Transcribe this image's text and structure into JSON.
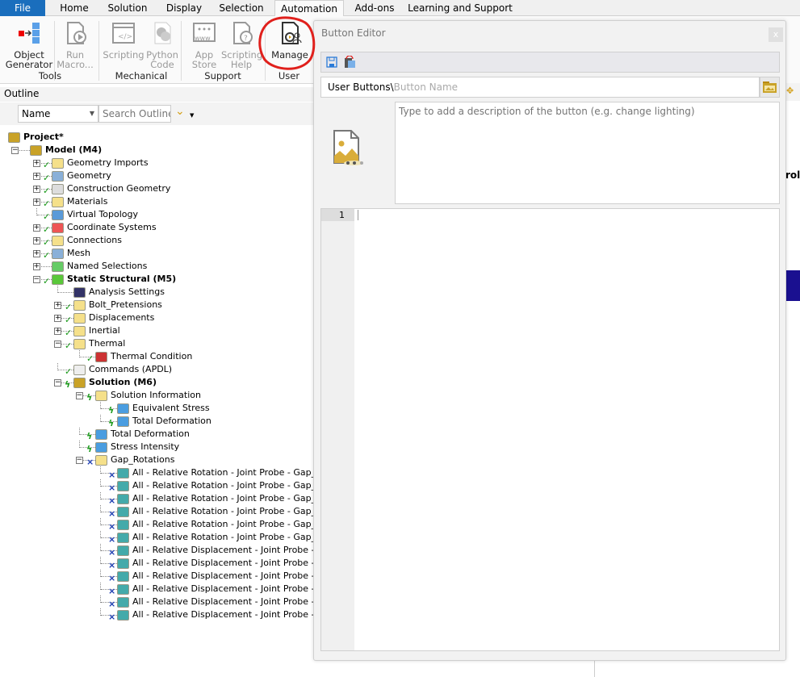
{
  "tabs": [
    "File",
    "Home",
    "Solution",
    "Display",
    "Selection",
    "Automation",
    "Add-ons",
    "Learning and Support"
  ],
  "ribbon": {
    "buttons": [
      {
        "label1": "Object",
        "label2": "Generator",
        "disabled": false,
        "icon": "object-generator-icon"
      },
      {
        "label1": "Run",
        "label2": "Macro...",
        "disabled": true,
        "icon": "run-macro-icon"
      },
      {
        "label1": "Scripting",
        "label2": "",
        "disabled": true,
        "icon": "scripting-icon"
      },
      {
        "label1": "Python",
        "label2": "Code",
        "disabled": true,
        "icon": "python-code-icon"
      },
      {
        "label1": "App",
        "label2": "Store",
        "disabled": true,
        "icon": "app-store-icon"
      },
      {
        "label1": "Scripting",
        "label2": "Help",
        "disabled": true,
        "icon": "scripting-help-icon"
      },
      {
        "label1": "Manage",
        "label2": "",
        "disabled": false,
        "icon": "manage-icon"
      }
    ],
    "groups": [
      "Tools",
      "Mechanical",
      "Support",
      "User"
    ],
    "annotation_color": "#e0201c"
  },
  "outline": {
    "title": "Outline",
    "filter_value": "Name",
    "search_placeholder": "Search Outline"
  },
  "tree": [
    {
      "t": "Project*",
      "l": 0,
      "b": true,
      "e": "",
      "s": "",
      "i": "project"
    },
    {
      "t": "Model (M4)",
      "l": 1,
      "b": true,
      "e": "-",
      "s": "",
      "i": "model"
    },
    {
      "t": "Geometry Imports",
      "l": 2,
      "e": "+",
      "s": "ok",
      "i": "folder"
    },
    {
      "t": "Geometry",
      "l": 2,
      "e": "+",
      "s": "ok",
      "i": "geometry"
    },
    {
      "t": "Construction Geometry",
      "l": 2,
      "e": "+",
      "s": "ok",
      "i": "construction"
    },
    {
      "t": "Materials",
      "l": 2,
      "e": "+",
      "s": "ok",
      "i": "folder"
    },
    {
      "t": "Virtual Topology",
      "l": 2,
      "e": "",
      "s": "ok",
      "i": "topology"
    },
    {
      "t": "Coordinate Systems",
      "l": 2,
      "e": "+",
      "s": "ok",
      "i": "coords"
    },
    {
      "t": "Connections",
      "l": 2,
      "e": "+",
      "s": "ok",
      "i": "folder"
    },
    {
      "t": "Mesh",
      "l": 2,
      "e": "+",
      "s": "ok",
      "i": "geometry"
    },
    {
      "t": "Named Selections",
      "l": 2,
      "e": "+",
      "s": "",
      "i": "named"
    },
    {
      "t": "Static Structural (M5)",
      "l": 2,
      "b": true,
      "e": "-",
      "s": "ok",
      "i": "analysis"
    },
    {
      "t": "Analysis Settings",
      "l": 3,
      "e": "",
      "s": "",
      "i": "settings"
    },
    {
      "t": "Bolt_Pretensions",
      "l": 3,
      "e": "+",
      "s": "ok",
      "i": "folder"
    },
    {
      "t": "Displacements",
      "l": 3,
      "e": "+",
      "s": "ok",
      "i": "folder"
    },
    {
      "t": "Inertial",
      "l": 3,
      "e": "+",
      "s": "ok",
      "i": "folder"
    },
    {
      "t": "Thermal",
      "l": 3,
      "e": "-",
      "s": "ok",
      "i": "folder"
    },
    {
      "t": "Thermal Condition",
      "l": 4,
      "e": "",
      "s": "ok",
      "i": "thermal"
    },
    {
      "t": "Commands (APDL)",
      "l": 3,
      "e": "",
      "s": "ok",
      "i": "commands"
    },
    {
      "t": "Solution (M6)",
      "l": 3,
      "b": true,
      "e": "-",
      "s": "bolt",
      "i": "solution"
    },
    {
      "t": "Solution Information",
      "l": 4,
      "e": "-",
      "s": "bolt",
      "i": "info"
    },
    {
      "t": "Equivalent Stress",
      "l": 5,
      "e": "",
      "s": "bolt",
      "i": "result"
    },
    {
      "t": "Total Deformation",
      "l": 5,
      "e": "",
      "s": "bolt",
      "i": "result"
    },
    {
      "t": "Total Deformation",
      "l": 4,
      "e": "",
      "s": "bolt",
      "i": "result"
    },
    {
      "t": "Stress Intensity",
      "l": 4,
      "e": "",
      "s": "bolt",
      "i": "result"
    },
    {
      "t": "Gap_Rotations",
      "l": 4,
      "e": "-",
      "s": "x",
      "i": "folder"
    },
    {
      "t": "All - Relative Rotation - Joint Probe - Gap_Joint",
      "l": 5,
      "e": "",
      "s": "x",
      "i": "probe"
    },
    {
      "t": "All - Relative Rotation - Joint Probe - Gap_Joint",
      "l": 5,
      "e": "",
      "s": "x",
      "i": "probe"
    },
    {
      "t": "All - Relative Rotation - Joint Probe - Gap_Joint",
      "l": 5,
      "e": "",
      "s": "x",
      "i": "probe"
    },
    {
      "t": "All - Relative Rotation - Joint Probe - Gap_Joint",
      "l": 5,
      "e": "",
      "s": "x",
      "i": "probe"
    },
    {
      "t": "All - Relative Rotation - Joint Probe - Gap_Joint",
      "l": 5,
      "e": "",
      "s": "x",
      "i": "probe"
    },
    {
      "t": "All - Relative Rotation - Joint Probe - Gap_Joint",
      "l": 5,
      "e": "",
      "s": "x",
      "i": "probe"
    },
    {
      "t": "All - Relative Displacement - Joint Probe - Gap_",
      "l": 5,
      "e": "",
      "s": "x",
      "i": "probe"
    },
    {
      "t": "All - Relative Displacement - Joint Probe - Gap_",
      "l": 5,
      "e": "",
      "s": "x",
      "i": "probe"
    },
    {
      "t": "All - Relative Displacement - Joint Probe - Gap_",
      "l": 5,
      "e": "",
      "s": "x",
      "i": "probe"
    },
    {
      "t": "All - Relative Displacement - Joint Probe - Gap_",
      "l": 5,
      "e": "",
      "s": "x",
      "i": "probe"
    },
    {
      "t": "All - Relative Displacement - Joint Probe - Gap_",
      "l": 5,
      "e": "",
      "s": "x",
      "i": "probe"
    },
    {
      "t": "All - Relative Displacement - Joint Probe - Gap_",
      "l": 5,
      "e": "",
      "s": "x",
      "i": "probe"
    }
  ],
  "dialog": {
    "title": "Button Editor",
    "close": "x",
    "path_prefix": "User Buttons\\",
    "name_placeholder": "Button Name",
    "description_placeholder": "Type to add a description of the button (e.g. change lighting)",
    "line_number": "1"
  },
  "background": {
    "partial_text": "roll",
    "bar_color": "#1a1090"
  }
}
